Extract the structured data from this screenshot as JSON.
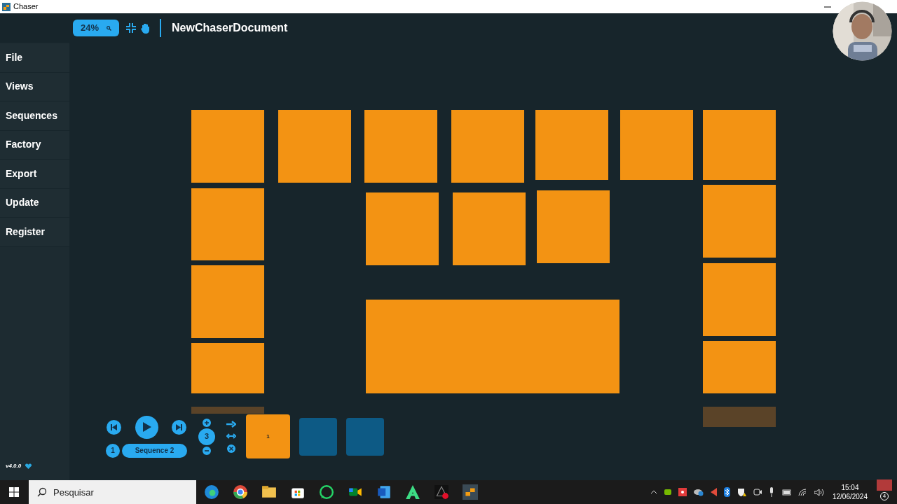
{
  "window": {
    "title": "Chaser"
  },
  "toolbar": {
    "zoom": "24%",
    "document": "NewChaserDocument"
  },
  "sidebar": {
    "items": [
      {
        "label": "File"
      },
      {
        "label": "Views"
      },
      {
        "label": "Sequences"
      },
      {
        "label": "Factory"
      },
      {
        "label": "Export"
      },
      {
        "label": "Update"
      },
      {
        "label": "Register"
      }
    ],
    "version": "v4.0.0"
  },
  "sequence_bar": {
    "index": "1",
    "name": "Sequence 2",
    "count": "3",
    "steps": [
      {
        "label": "1",
        "selected": true
      },
      {
        "selected": false
      },
      {
        "selected": false
      }
    ]
  },
  "taskbar": {
    "search": {
      "placeholder": "Pesquisar"
    },
    "time": "15:04",
    "date": "12/06/2024",
    "notifications": "4"
  }
}
